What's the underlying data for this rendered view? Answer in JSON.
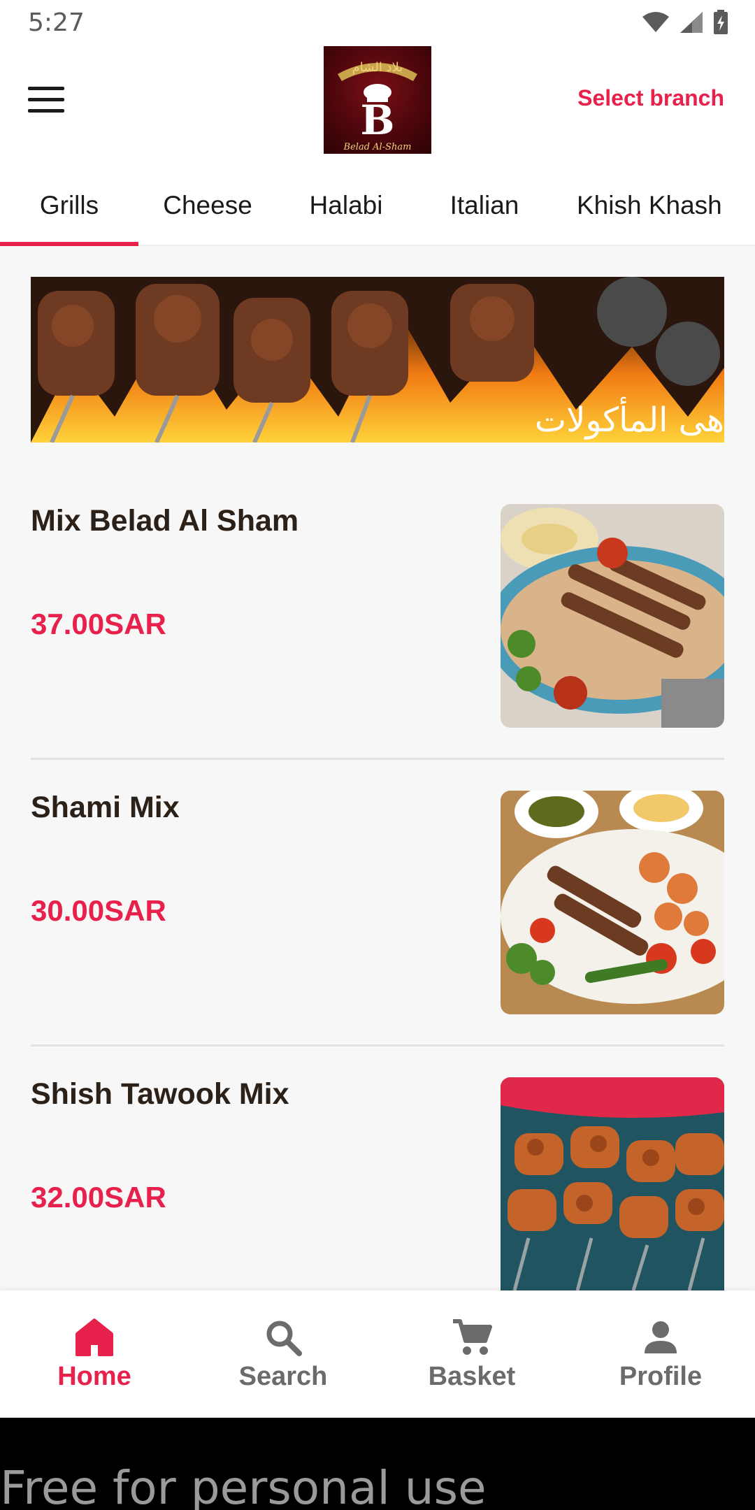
{
  "status_bar": {
    "time": "5:27",
    "icons": [
      "wifi-icon",
      "cellular-signal-icon",
      "battery-charging-icon"
    ]
  },
  "header": {
    "logo": {
      "arabic_text": "بلاد الشام",
      "monogram": "B",
      "script_text": "Belad Al-Sham"
    },
    "select_branch_label": "Select branch"
  },
  "tabs": [
    {
      "label": "Grills",
      "active": true
    },
    {
      "label": "Cheese",
      "active": false
    },
    {
      "label": "Halabi",
      "active": false
    },
    {
      "label": "Italian",
      "active": false
    },
    {
      "label": "Khish Khash",
      "active": false
    }
  ],
  "banner": {
    "text": "هى المأكولات"
  },
  "menu_items": [
    {
      "name": "Mix Belad Al Sham",
      "price": "37.00SAR"
    },
    {
      "name": "Shami Mix",
      "price": "30.00SAR"
    },
    {
      "name": "Shish Tawook Mix",
      "price": "32.00SAR"
    }
  ],
  "bottom_nav": [
    {
      "label": "Home",
      "icon": "home-icon",
      "active": true
    },
    {
      "label": "Search",
      "icon": "search-icon",
      "active": false
    },
    {
      "label": "Basket",
      "icon": "cart-icon",
      "active": false
    },
    {
      "label": "Profile",
      "icon": "person-icon",
      "active": false
    }
  ],
  "watermark": {
    "text": "Free for personal use"
  },
  "colors": {
    "accent": "#e8204c",
    "text_dark": "#2b2118",
    "nav_inactive": "#6b6b6b",
    "background": "#f7f7f8"
  }
}
